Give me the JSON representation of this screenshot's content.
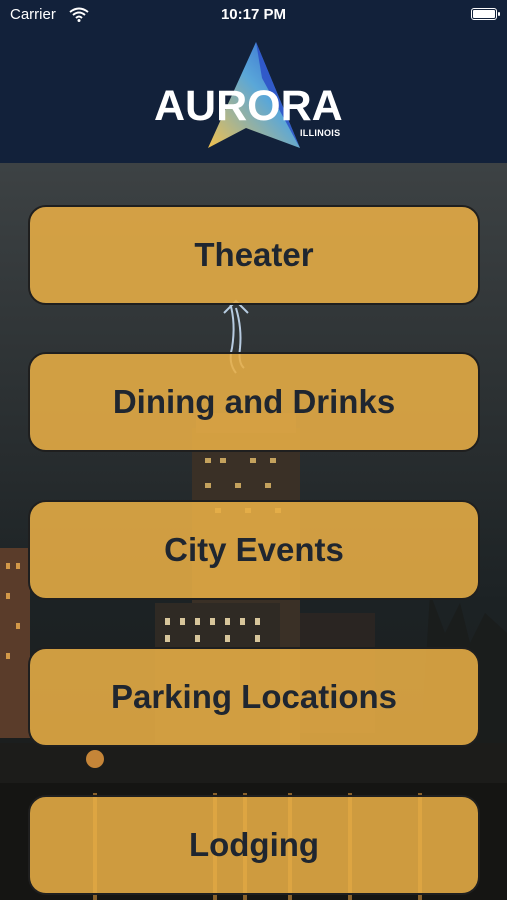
{
  "status_bar": {
    "carrier": "Carrier",
    "time": "10:17 PM"
  },
  "header": {
    "logo_text": "AURORA",
    "logo_subtext": "ILLINOIS"
  },
  "menu": {
    "items": [
      {
        "label": "Theater"
      },
      {
        "label": "Dining and Drinks"
      },
      {
        "label": "City Events"
      },
      {
        "label": "Parking Locations"
      },
      {
        "label": "Lodging"
      }
    ]
  },
  "colors": {
    "header_bg": "#12213a",
    "button_bg": "#e8ae45",
    "button_text": "#1f2630"
  }
}
